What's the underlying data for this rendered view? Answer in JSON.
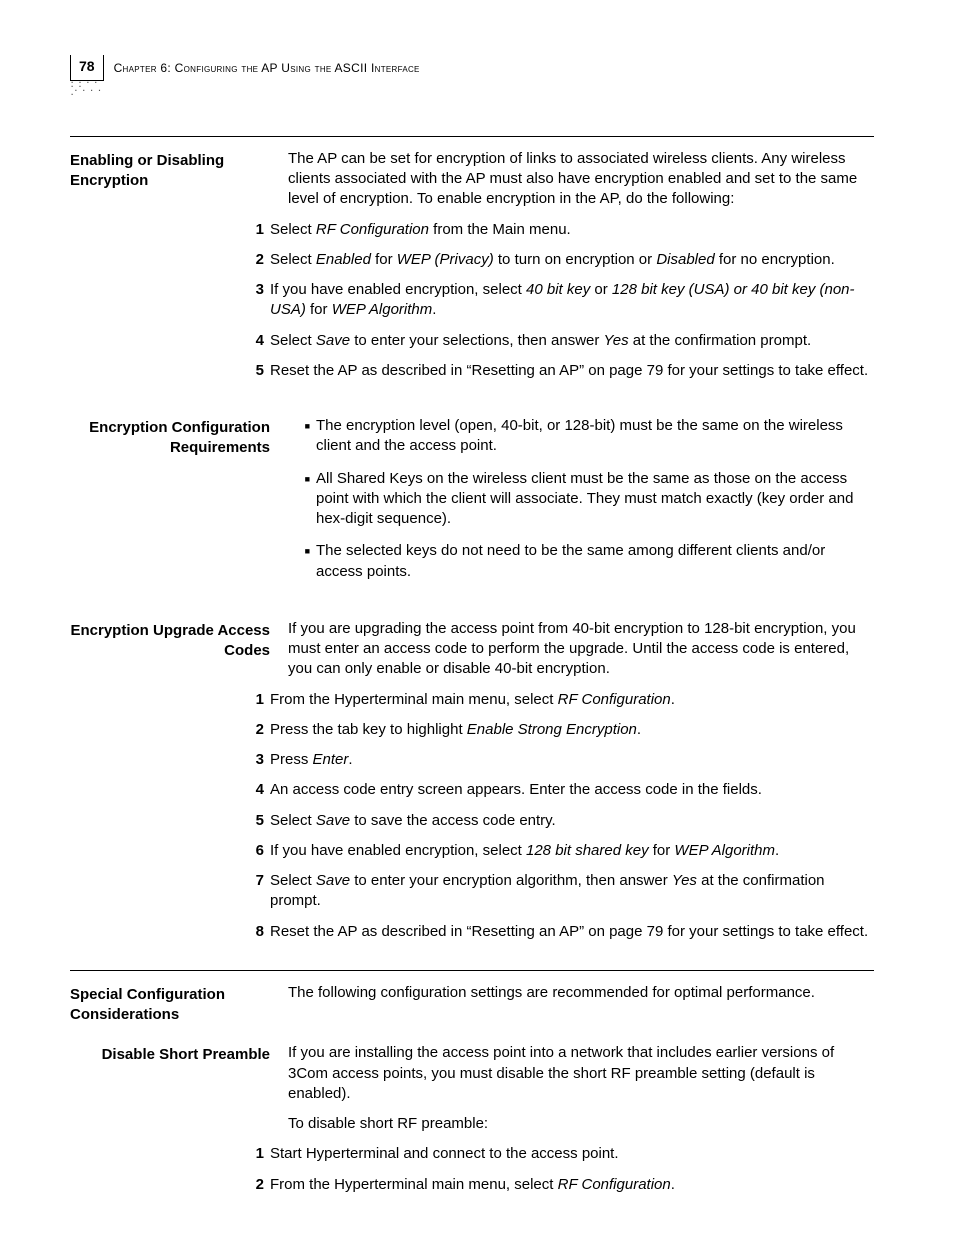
{
  "page": {
    "number": "78",
    "chapter_line": "Chapter 6: Configuring the AP Using the ASCII Interface"
  },
  "s1": {
    "heading": "Enabling or Disabling Encryption",
    "intro_a": "The AP can be set for encryption of links to associated wireless clients. Any wireless clients associated with the AP must also have encryption enabled and set to the same level of encryption. To enable encryption in the AP, do the following:",
    "step1_pre": "Select ",
    "step1_it": "RF Configuration",
    "step1_post": " from the Main menu.",
    "step2_pre": "Select ",
    "step2_it1": "Enabled",
    "step2_mid1": " for ",
    "step2_it2": "WEP (Privacy)",
    "step2_mid2": " to turn on encryption or ",
    "step2_it3": "Disabled",
    "step2_post": " for no encryption.",
    "step3_pre": "If you have enabled encryption, select ",
    "step3_it1": "40 bit key",
    "step3_mid1": " or ",
    "step3_it2": "128 bit key (USA) or 40 bit key (non-USA)",
    "step3_mid2": " for ",
    "step3_it3": "WEP Algorithm",
    "step3_post": ".",
    "step4_pre": "Select ",
    "step4_it1": "Save",
    "step4_mid": " to enter your selections, then answer ",
    "step4_it2": "Yes",
    "step4_post": " at the confirmation prompt.",
    "step5": "Reset the AP as described in “Resetting an AP” on page 79 for your settings to take effect."
  },
  "s1b": {
    "heading": "Encryption Configuration Requirements",
    "bullet1": "The encryption level (open, 40-bit, or 128-bit) must be the same on the wireless client and the access point.",
    "bullet2": "All Shared Keys on the wireless client must be the same as those on the access point with which the client will associate.  They must match exactly (key order and hex-digit sequence).",
    "bullet3": "The selected keys do not need to be the same among different clients and/or access points."
  },
  "s1c": {
    "heading": "Encryption Upgrade Access Codes",
    "intro": "If you are upgrading the access point from 40-bit encryption to 128-bit encryption, you must enter an access code to perform the upgrade. Until the access code is entered, you can only enable or disable 40-bit encryption.",
    "step1_pre": "From the Hyperterminal main menu, select ",
    "step1_it": "RF Configuration",
    "step1_post": ".",
    "step2_pre": "Press the tab key to highlight ",
    "step2_it": "Enable Strong Encryption",
    "step2_post": ".",
    "step3_pre": "Press ",
    "step3_it": "Enter",
    "step3_post": ".",
    "step4": "An access code entry screen appears.  Enter the access code in the fields.",
    "step5_pre": "Select ",
    "step5_it": "Save",
    "step5_post": " to save the access code entry.",
    "step6_pre": "If you have enabled encryption, select ",
    "step6_it1": "128 bit shared key",
    "step6_mid": " for ",
    "step6_it2": "WEP Algorithm",
    "step6_post": ".",
    "step7_pre": "Select ",
    "step7_it1": "Save",
    "step7_mid": " to enter your encryption algorithm, then answer ",
    "step7_it2": "Yes",
    "step7_post": " at the confirmation prompt.",
    "step8": "Reset the AP as described in “Resetting an AP” on page 79 for your settings to take effect."
  },
  "s2": {
    "heading": "Special Configuration Considerations",
    "intro": "The following configuration settings are recommended for optimal performance."
  },
  "s2a": {
    "heading": "Disable Short Preamble",
    "p1": "If you are installing the access point into a network that includes earlier versions of 3Com access points, you must disable the short RF preamble setting (default is enabled).",
    "p2": "To disable short RF preamble:",
    "step1": "Start Hyperterminal and connect to the access point.",
    "step2_pre": "From the Hyperterminal main menu, select ",
    "step2_it": "RF Configuration",
    "step2_post": "."
  },
  "nums": {
    "n1": "1",
    "n2": "2",
    "n3": "3",
    "n4": "4",
    "n5": "5",
    "n6": "6",
    "n7": "7",
    "n8": "8"
  },
  "sq": "■"
}
